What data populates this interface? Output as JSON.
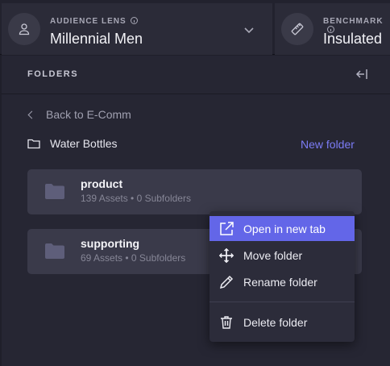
{
  "audience": {
    "kicker": "AUDIENCE LENS",
    "value": "Millennial Men"
  },
  "benchmark": {
    "kicker": "BENCHMARK",
    "value": "Insulated"
  },
  "panel": {
    "title": "FOLDERS",
    "back_label": "Back to E-Comm",
    "current_folder": "Water Bottles",
    "new_folder_label": "New folder"
  },
  "folders": [
    {
      "name": "product",
      "meta": "139 Assets • 0 Subfolders"
    },
    {
      "name": "supporting",
      "meta": "69 Assets • 0 Subfolders"
    }
  ],
  "context_menu": {
    "items": [
      {
        "label": "Open in new tab",
        "icon": "external-link-icon",
        "active": true
      },
      {
        "label": "Move folder",
        "icon": "move-icon"
      },
      {
        "label": "Rename folder",
        "icon": "pencil-icon"
      },
      {
        "label": "Delete folder",
        "icon": "trash-icon"
      }
    ]
  },
  "colors": {
    "accent": "#6366e8",
    "link": "#7c7cf6",
    "card": "#3a3a4a",
    "background": "#262633"
  }
}
